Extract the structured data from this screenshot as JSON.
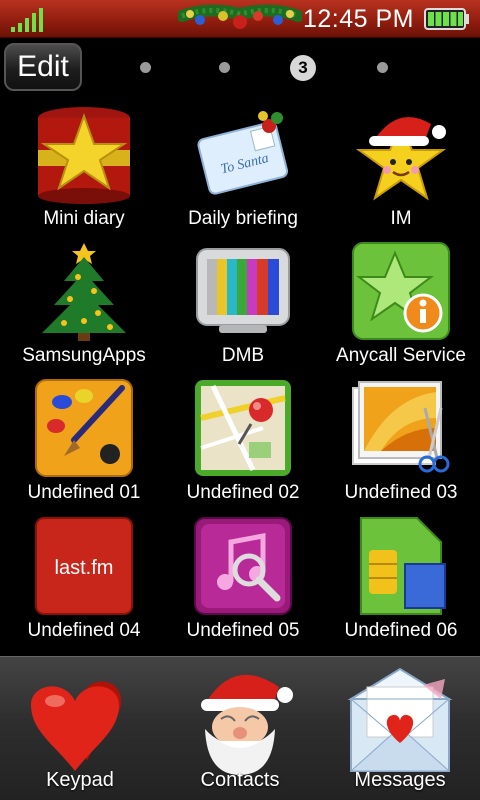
{
  "status_bar": {
    "time": "12:45 PM",
    "signal_icon": "signal-strength-icon",
    "battery_icon": "battery-full-icon",
    "decoration_icon": "christmas-garland-icon"
  },
  "toolbar": {
    "edit_label": "Edit",
    "current_page": "3"
  },
  "apps": [
    {
      "label": "Mini diary",
      "icon": "gift-box-star-icon"
    },
    {
      "label": "Daily briefing",
      "icon": "santa-letter-icon"
    },
    {
      "label": "IM",
      "icon": "star-santa-hat-icon"
    },
    {
      "label": "SamsungApps",
      "icon": "christmas-tree-icon"
    },
    {
      "label": "DMB",
      "icon": "tv-color-bars-icon"
    },
    {
      "label": "Anycall Service",
      "icon": "star-info-icon"
    },
    {
      "label": "Undefined 01",
      "icon": "paint-palette-icon"
    },
    {
      "label": "Undefined 02",
      "icon": "map-pin-icon"
    },
    {
      "label": "Undefined 03",
      "icon": "photo-scissors-icon"
    },
    {
      "label": "Undefined 04",
      "icon": "lastfm-icon",
      "icon_text": "last.fm"
    },
    {
      "label": "Undefined 05",
      "icon": "music-search-icon"
    },
    {
      "label": "Undefined 06",
      "icon": "sim-card-icon"
    }
  ],
  "dock": [
    {
      "label": "Keypad",
      "icon": "hearts-keypad-icon"
    },
    {
      "label": "Contacts",
      "icon": "santa-face-icon"
    },
    {
      "label": "Messages",
      "icon": "envelope-heart-icon"
    }
  ],
  "colors": {
    "status_bar": "#8e1c0e",
    "background": "#000000",
    "dock": "#2e2e2e"
  }
}
